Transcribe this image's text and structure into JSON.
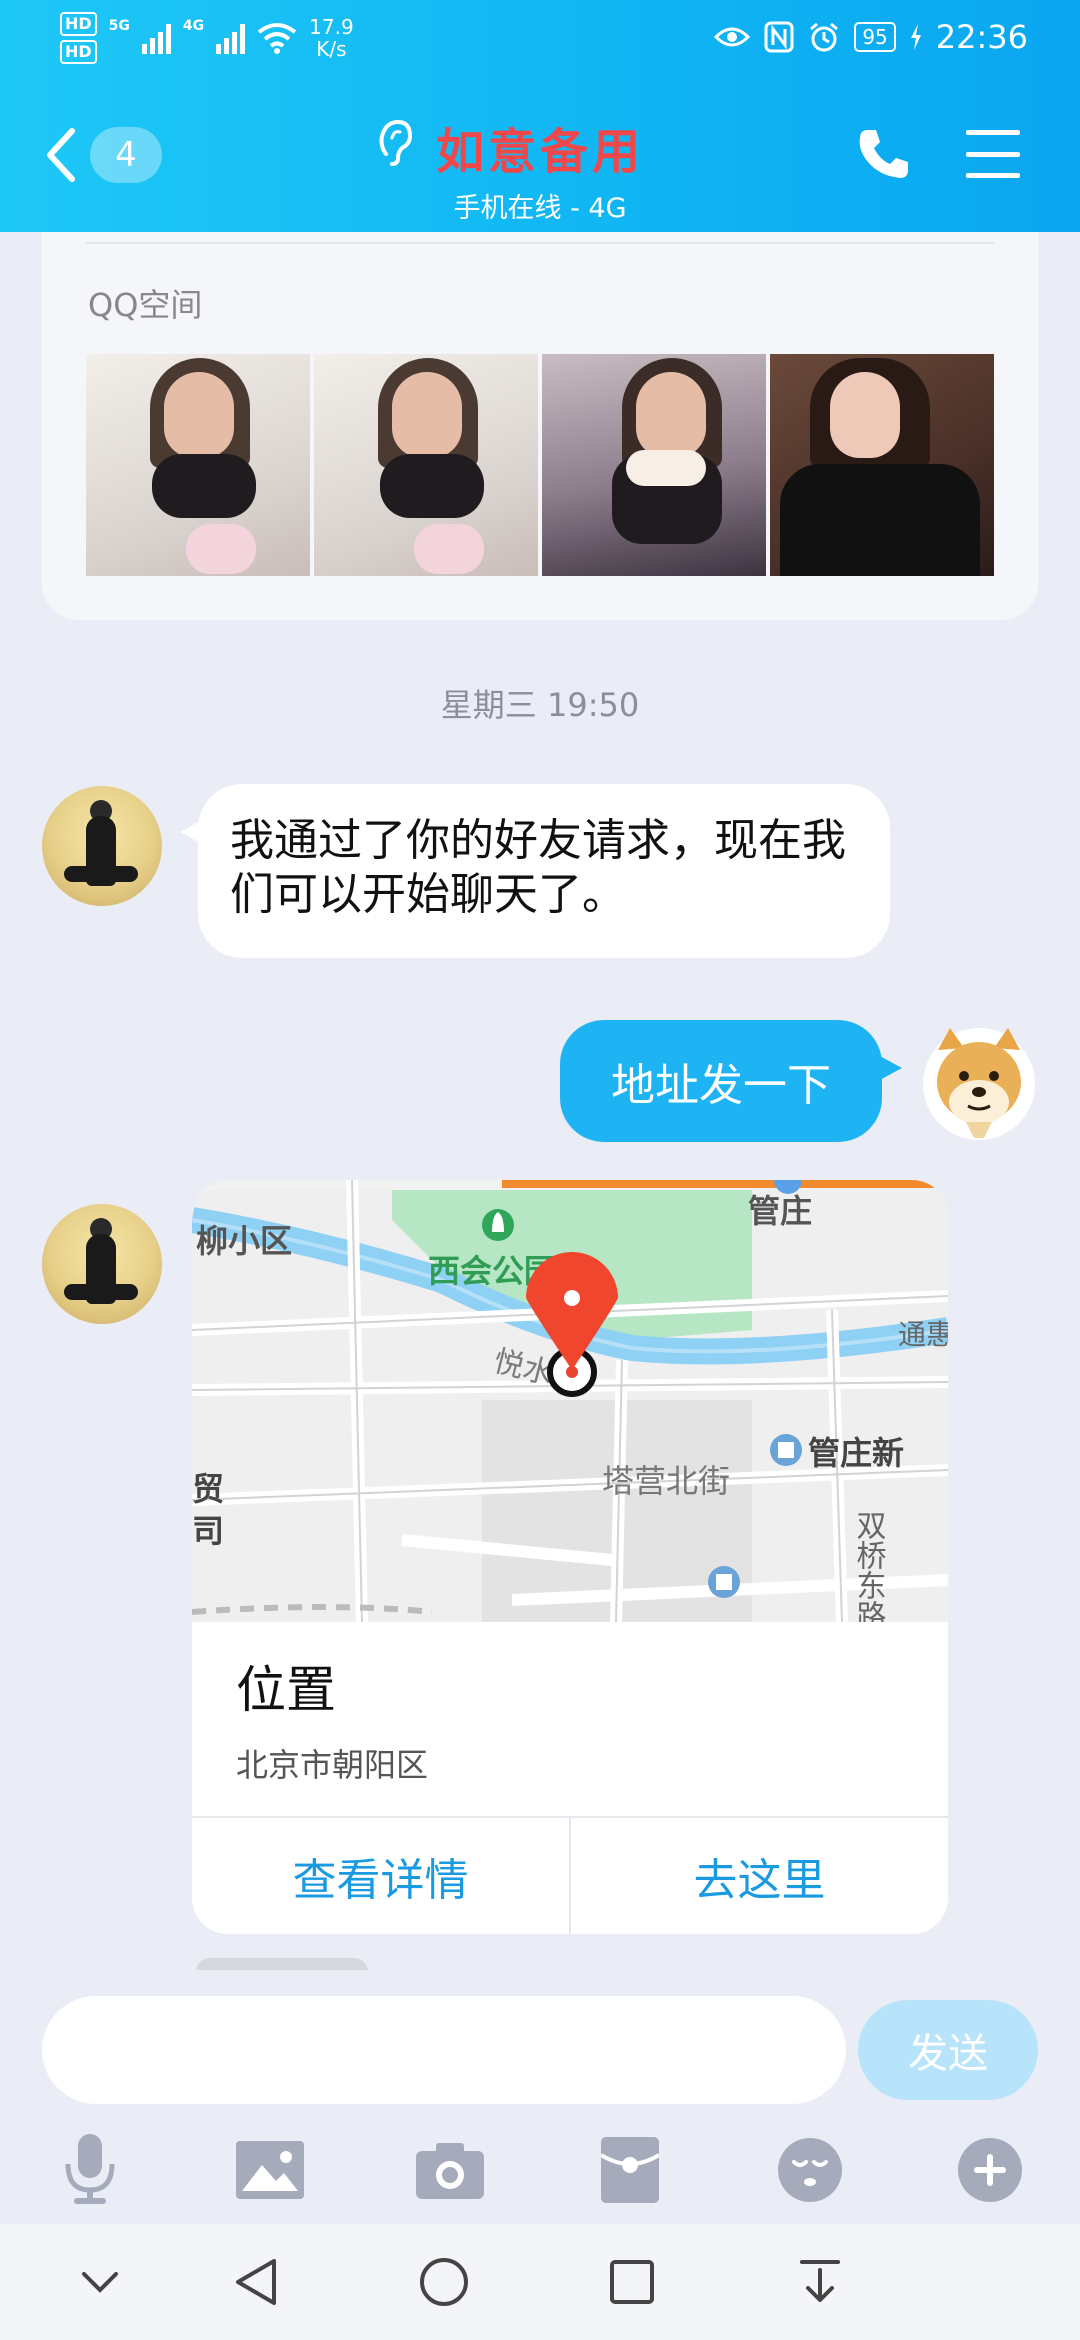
{
  "status_bar": {
    "sim1": "HD",
    "sim2": "HD",
    "net1": "5G",
    "net2": "4G",
    "speed_value": "17.9",
    "speed_unit": "K/s",
    "battery": "95",
    "time": "22:36"
  },
  "header": {
    "unread_count": "4",
    "contact_name": "如意备用",
    "contact_status": "手机在线 - 4G"
  },
  "qzone": {
    "label": "QQ空间"
  },
  "messages": {
    "timestamp": "星期三 19:50",
    "incoming_text": "我通过了你的好友请求，现在我们可以开始聊天了。",
    "outgoing_text": "地址发一下"
  },
  "location_card": {
    "map_labels": [
      "柳小区",
      "西会公园",
      "管庄",
      "悦水",
      "塔营北街",
      "管庄新",
      "双桥东路",
      "通惠",
      "贸",
      "司"
    ],
    "title": "位置",
    "address": "北京市朝阳区",
    "view_details": "查看详情",
    "go_here": "去这里"
  },
  "composer": {
    "input_value": "",
    "send_label": "发送"
  },
  "toolbar_icons": [
    "microphone-icon",
    "image-icon",
    "camera-icon",
    "red-packet-icon",
    "emoji-icon",
    "plus-icon"
  ],
  "system_nav_icons": [
    "collapse-icon",
    "back-icon",
    "home-icon",
    "recents-icon",
    "pull-down-icon"
  ],
  "colors": {
    "header_gradient_start": "#1ec8f6",
    "header_gradient_end": "#0aa6f0",
    "contact_name": "#f0484a",
    "outgoing_bubble": "#1eb3f3",
    "action_link": "#1a9ae0",
    "chat_background": "#eaedf5"
  }
}
